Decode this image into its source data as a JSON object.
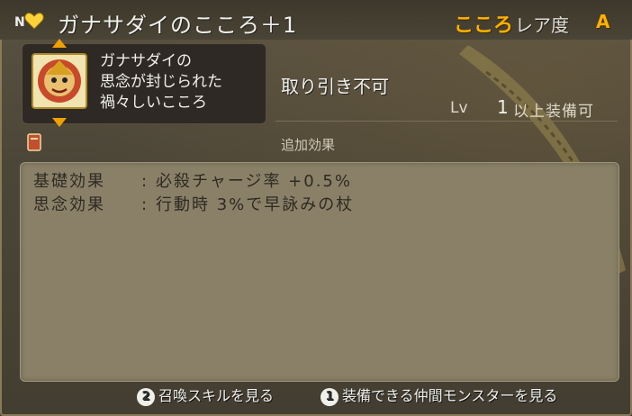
{
  "header": {
    "rank": "N",
    "title": "ガナサダイのこころ＋1",
    "kokoro_label": "こころ",
    "rarity_label": "レア度",
    "rarity_value": "A"
  },
  "item": {
    "icon": "ganasadai-heart-icon",
    "description": "ガナサダイの\n思念が封じられた\n禍々しいこころ",
    "trade_status": "取り引き不可",
    "level_label": "Lv",
    "level_value": "1",
    "level_suffix": "以上装備可"
  },
  "effects": {
    "section_label": "追加効果",
    "rows": [
      {
        "label": "基礎効果",
        "colon": ":",
        "value": "必殺チャージ率 +0.5%"
      },
      {
        "label": "思念効果",
        "colon": ":",
        "value": "行動時 3%で早詠みの杖"
      }
    ]
  },
  "footer": {
    "button2_num": "2",
    "button2_label": "召喚スキルを見る",
    "button1_num": "1",
    "button1_label": "装備できる仲間モンスターを見る"
  },
  "colors": {
    "accent": "#ffb000",
    "panel": "#8a8068"
  }
}
